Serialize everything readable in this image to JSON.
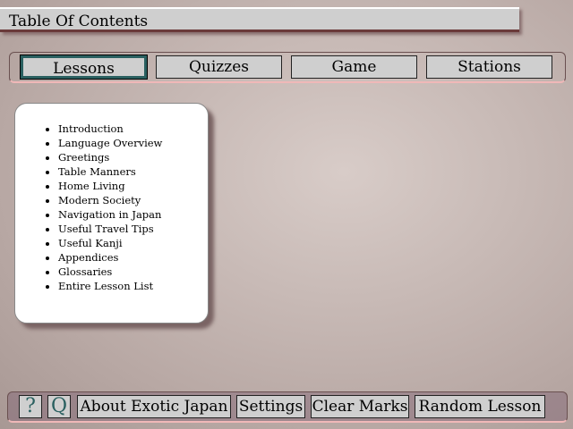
{
  "title": "Table Of Contents",
  "nav": [
    "Lessons",
    "Quizzes",
    "Game",
    "Stations"
  ],
  "lessons": [
    "Introduction",
    "Language Overview",
    "Greetings",
    "Table Manners",
    "Home Living",
    "Modern Society",
    "Navigation in Japan",
    "Useful Travel Tips",
    "Useful Kanji",
    "Appendices",
    "Glossaries",
    "Entire Lesson List"
  ],
  "bottom": {
    "help": "?",
    "quit": "Q",
    "about": "About Exotic Japan",
    "settings": "Settings",
    "clear": "Clear Marks",
    "random": "Random Lesson"
  }
}
